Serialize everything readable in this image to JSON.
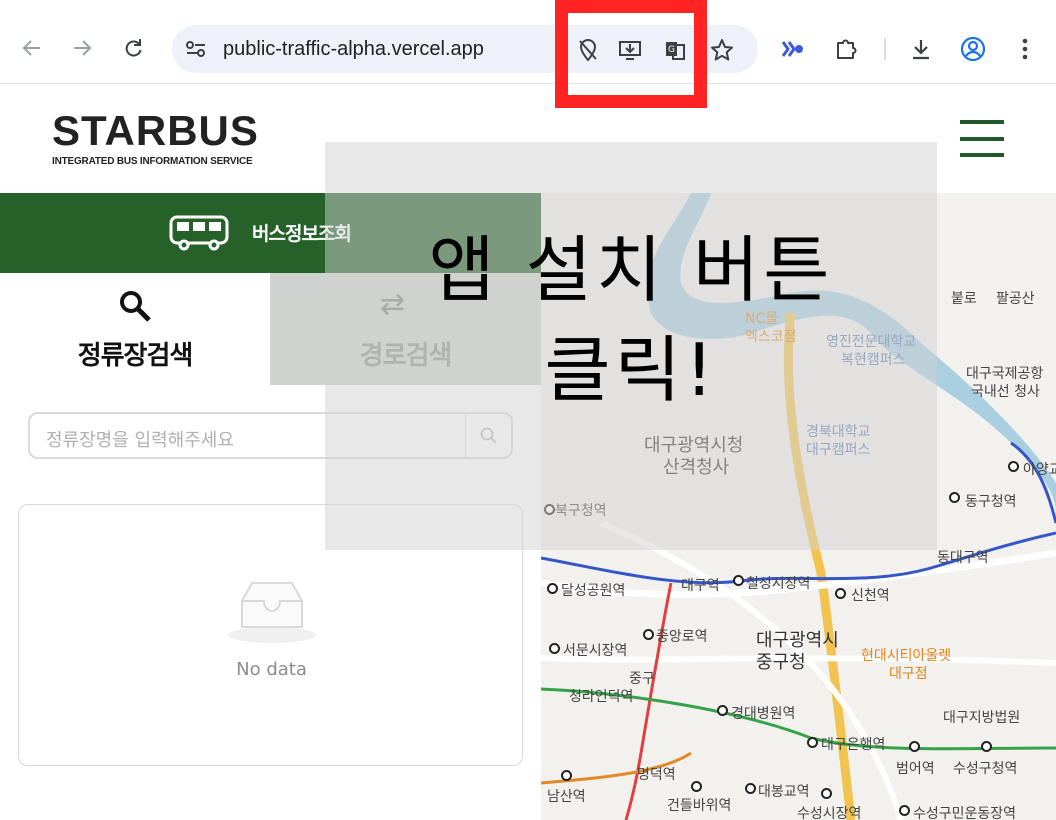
{
  "browser": {
    "url": "public-traffic-alpha.vercel.app",
    "icons": [
      "back-arrow-icon",
      "forward-arrow-icon",
      "reload-icon",
      "site-info-icon",
      "location-off-icon",
      "install-app-icon",
      "translate-icon",
      "bookmark-star-icon",
      "extension-brand-icon",
      "extensions-puzzle-icon",
      "download-icon",
      "profile-icon",
      "more-menu-icon"
    ]
  },
  "annotation": {
    "highlight_color": "#ff2323",
    "overlay_text": "앱 설치 버튼\n클릭!"
  },
  "header": {
    "logo_title": "STARBUS",
    "logo_subtitle": "INTEGRATED BUS INFORMATION SERVICE"
  },
  "menu": {
    "bus_info_label": "버스정보조회",
    "accent_color": "#256129"
  },
  "tabs": [
    {
      "label": "정류장검색",
      "active": true
    },
    {
      "label": "경로검색",
      "active": false
    }
  ],
  "search": {
    "placeholder": "정류장명을 입력해주세요"
  },
  "results": {
    "empty_text": "No data"
  },
  "map": {
    "labels": [
      "붙로",
      "팔공산",
      "대구국제공항",
      "국내선 청사",
      "NC몰",
      "엑스코점",
      "영진전문대학교",
      "복현캠퍼스",
      "경북대학교",
      "대구캠퍼스",
      "대구광역시청",
      "산격청사",
      "아양교",
      "동구청역",
      "북구청역",
      "동대구역",
      "달성공원역",
      "대구역",
      "칠성시장역",
      "신천역",
      "중앙로역",
      "서문시장역",
      "대구광역시",
      "중구청",
      "현대시티아울렛",
      "대구점",
      "중구",
      "청라언덕역",
      "경대병원역",
      "대구지방법원",
      "대구은행역",
      "범어역",
      "수성구청역",
      "명덕역",
      "남산역",
      "대봉교역",
      "건들바위역",
      "수성시장역",
      "수성구민운동장역"
    ]
  }
}
